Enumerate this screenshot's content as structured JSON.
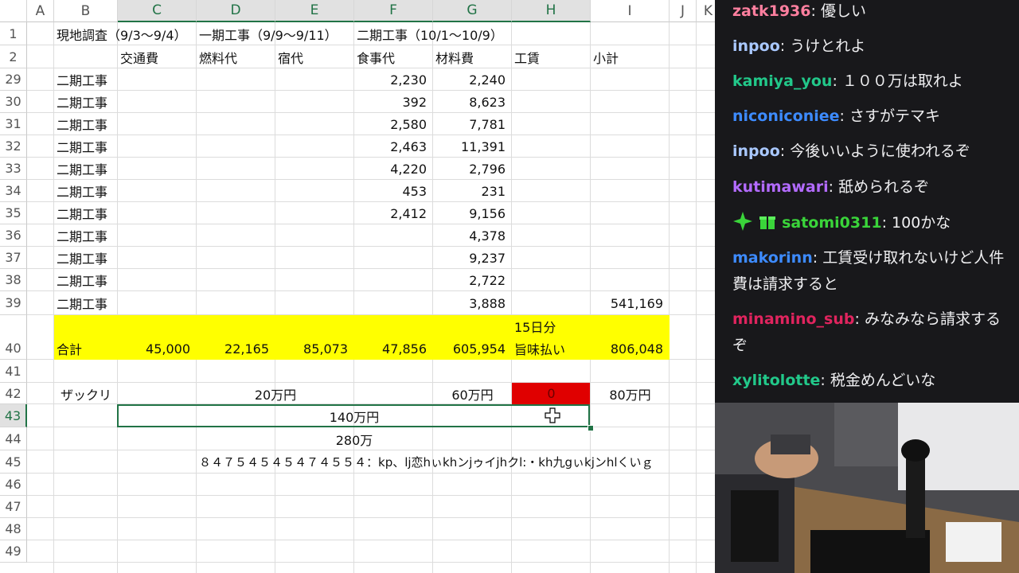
{
  "sheet": {
    "columns": [
      "A",
      "B",
      "C",
      "D",
      "E",
      "F",
      "G",
      "H",
      "I",
      "J",
      "K"
    ],
    "rows": [
      "1",
      "2",
      "29",
      "30",
      "31",
      "32",
      "33",
      "34",
      "35",
      "36",
      "37",
      "38",
      "39",
      "40",
      "41",
      "42",
      "43",
      "44",
      "45",
      "46",
      "47",
      "48",
      "49"
    ],
    "r1": {
      "b": "現地調査（9/3〜9/4）",
      "d": "一期工事（9/9〜9/11）",
      "f": "二期工事（10/1〜10/9）"
    },
    "r2": {
      "c": "交通費",
      "d": "燃料代",
      "e": "宿代",
      "f": "食事代",
      "g": "材料費",
      "h": "工賃",
      "i": "小計"
    },
    "data_rows": [
      {
        "b": "二期工事",
        "f": "2,230",
        "g": "2,240"
      },
      {
        "b": "二期工事",
        "f": "392",
        "g": "8,623"
      },
      {
        "b": "二期工事",
        "f": "2,580",
        "g": "7,781"
      },
      {
        "b": "二期工事",
        "f": "2,463",
        "g": "11,391"
      },
      {
        "b": "二期工事",
        "f": "4,220",
        "g": "2,796"
      },
      {
        "b": "二期工事",
        "f": "453",
        "g": "231"
      },
      {
        "b": "二期工事",
        "f": "2,412",
        "g": "9,156"
      },
      {
        "b": "二期工事",
        "f": "",
        "g": "4,378"
      },
      {
        "b": "二期工事",
        "f": "",
        "g": "9,237"
      },
      {
        "b": "二期工事",
        "f": "",
        "g": "2,722"
      },
      {
        "b": "二期工事",
        "f": "",
        "g": "3,888",
        "i": "541,169"
      }
    ],
    "total": {
      "b": "合計",
      "c": "45,000",
      "d": "22,165",
      "e": "85,073",
      "f": "47,856",
      "g": "605,954",
      "h1": "15日分",
      "h2": "旨味払い",
      "i": "806,048"
    },
    "r42": {
      "b": "ザックリ",
      "cde": "20万円",
      "g": "60万円",
      "h": "0",
      "i": "80万円"
    },
    "r43": "140万円",
    "r44": "280万",
    "r45": "８４７５４５４５４７４５５４：kp、lj恋hぃkhンjゥイjhクl:・kh九gぃkjンhlくいｇ"
  },
  "chat": [
    {
      "user": "zatk1936",
      "color": "#ff7f9f",
      "text": "優しい"
    },
    {
      "user": "inpoo",
      "color": "#a9c8ff",
      "text": "うけとれよ"
    },
    {
      "user": "kamiya_you",
      "color": "#22c88a",
      "text": "１００万は取れよ"
    },
    {
      "user": "niconiconiee",
      "color": "#3d8bff",
      "text": "さすがテマキ"
    },
    {
      "user": "inpoo",
      "color": "#a9c8ff",
      "text": "今後いいように使われるぞ"
    },
    {
      "user": "kutimawari",
      "color": "#b36bff",
      "text": "舐められるぞ"
    },
    {
      "user": "satomi0311",
      "color": "#3ad43a",
      "text": "100かな"
    },
    {
      "user": "makorinn",
      "color": "#3d8bff",
      "text": "工賃受け取れないけど人件費は請求すると"
    },
    {
      "user": "minamino_sub",
      "color": "#e0245e",
      "text": "みなみなら請求するぞ"
    },
    {
      "user": "xylitolotte",
      "color": "#22c88a",
      "text": "税金めんどいな"
    }
  ],
  "colors": {
    "accent": "#217346",
    "highlight": "#ffff00",
    "alert": "#e00000"
  }
}
